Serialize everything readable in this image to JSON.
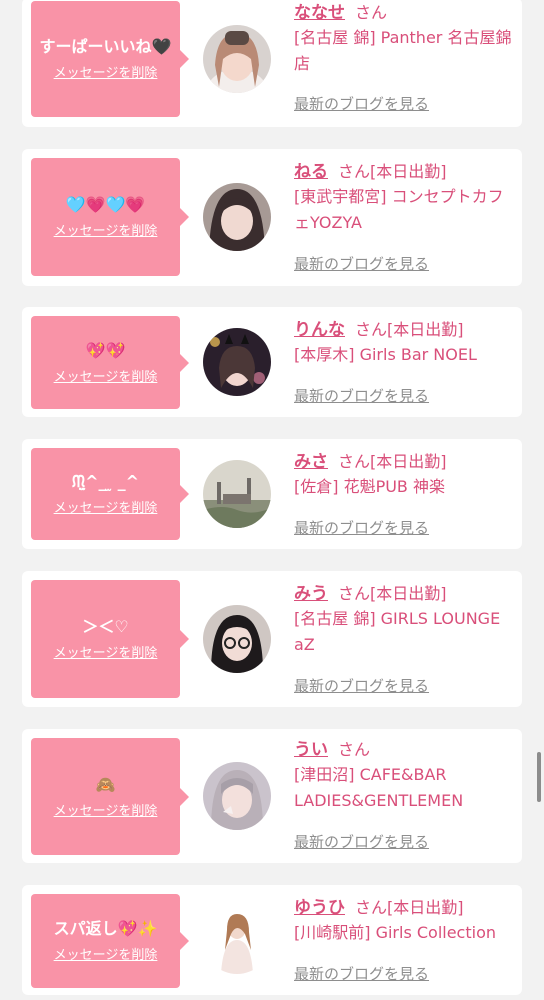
{
  "delete_label": "メッセージを削除",
  "blog_label": "最新のブログを見る",
  "honorific": "さん",
  "entries": [
    {
      "message": "すーぱーいいね🖤",
      "name": "ななせ",
      "status": "",
      "shop": "[名古屋 錦] Panther 名古屋錦店"
    },
    {
      "message": "🩵💗🩵💗",
      "name": "ねる",
      "status": "[本日出勤]",
      "shop": "[東武宇都宮] コンセプトカフェYOZYA"
    },
    {
      "message": "💖💖",
      "name": "りんな",
      "status": "[本日出勤]",
      "shop": "[本厚木] Girls Bar NOEL"
    },
    {
      "message": "ᙏ̤̫^_ ̫ _^",
      "name": "みさ",
      "status": "[本日出勤]",
      "shop": "[佐倉] 花魁PUB 神楽"
    },
    {
      "message": "＞＜♡",
      "name": "みう",
      "status": "[本日出勤]",
      "shop": "[名古屋 錦] GIRLS LOUNGE aZ"
    },
    {
      "message": "🙈",
      "name": "うい",
      "status": "",
      "shop": "[津田沼] CAFE&BAR LADIES&GENTLEMEN"
    },
    {
      "message": "スパ返し💖✨",
      "name": "ゆうひ",
      "status": "[本日出勤]",
      "shop": "[川崎駅前] Girls Collection"
    }
  ]
}
